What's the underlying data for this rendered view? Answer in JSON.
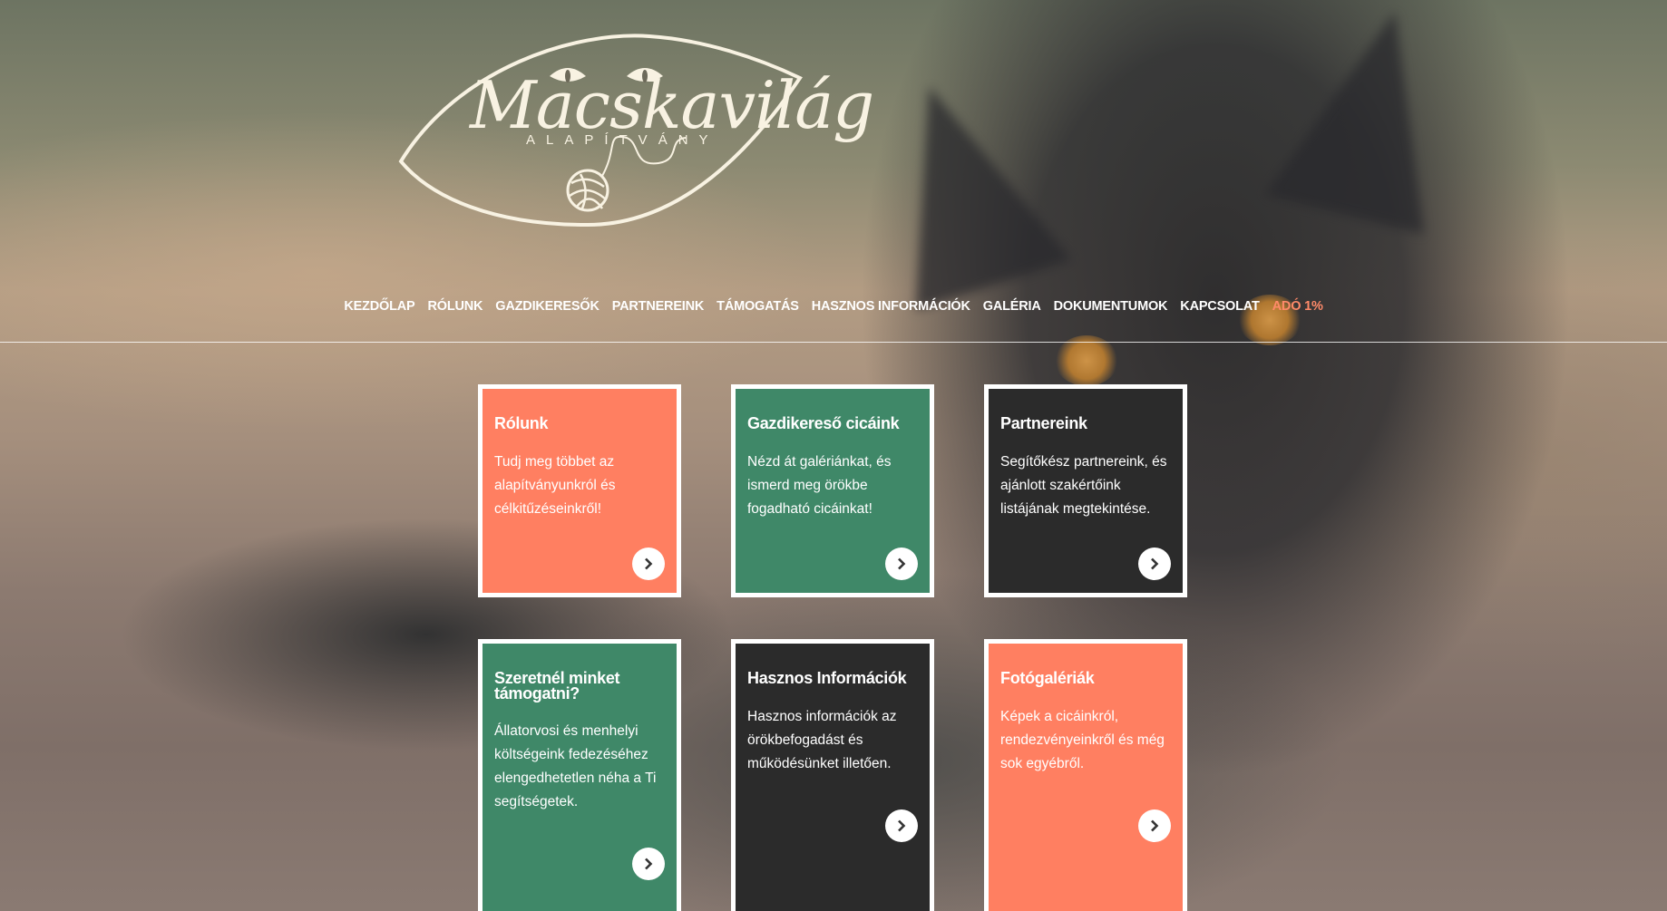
{
  "logo": {
    "title": "Macskavilág",
    "subtitle": "ALAPÍTVÁNY"
  },
  "nav": {
    "items": [
      {
        "label": "KEZDŐLAP"
      },
      {
        "label": "RÓLUNK"
      },
      {
        "label": "GAZDIKERESŐK"
      },
      {
        "label": "PARTNEREINK"
      },
      {
        "label": "TÁMOGATÁS"
      },
      {
        "label": "HASZNOS INFORMÁCIÓK"
      },
      {
        "label": "GALÉRIA"
      },
      {
        "label": "DOKUMENTUMOK"
      },
      {
        "label": "KAPCSOLAT"
      },
      {
        "label": "ADÓ 1%",
        "color": "#ff8a69"
      }
    ]
  },
  "cards": [
    {
      "title": "Rólunk",
      "text": "Tudj meg többet az alapítványunkról és célkitűzéseinkről!",
      "color": "#ff7f61",
      "button_icon": "chevron-right-icon"
    },
    {
      "title": "Gazdikereső cicáink",
      "text": "Nézd át galériánkat, és ismerd meg örökbe fogadható cicáinkat!",
      "color": "#3f8868",
      "button_icon": "chevron-right-icon"
    },
    {
      "title": "Partnereink",
      "text": "Segítőkész partnereink, és ajánlott szakértőink listájának megtekintése.",
      "color": "#2b2b2b",
      "button_icon": "chevron-right-icon"
    },
    {
      "title": "Szeretnél minket támogatni?",
      "text": "Állatorvosi és menhelyi költségeink fedezéséhez elengedhetetlen néha a Ti segítségetek.",
      "color": "#3f8868",
      "button_icon": "chevron-right-icon"
    },
    {
      "title": "Hasznos Információk",
      "text": "Hasznos információk az örökbefogadást és működésünket illetően.",
      "color": "#2b2b2b",
      "button_icon": "chevron-right-icon"
    },
    {
      "title": "Fotógalériák",
      "text": "Képek a cicáinkról, rendezvényeinkről és még sok egyébről.",
      "color": "#ff7f61",
      "button_icon": "chevron-right-icon"
    }
  ]
}
